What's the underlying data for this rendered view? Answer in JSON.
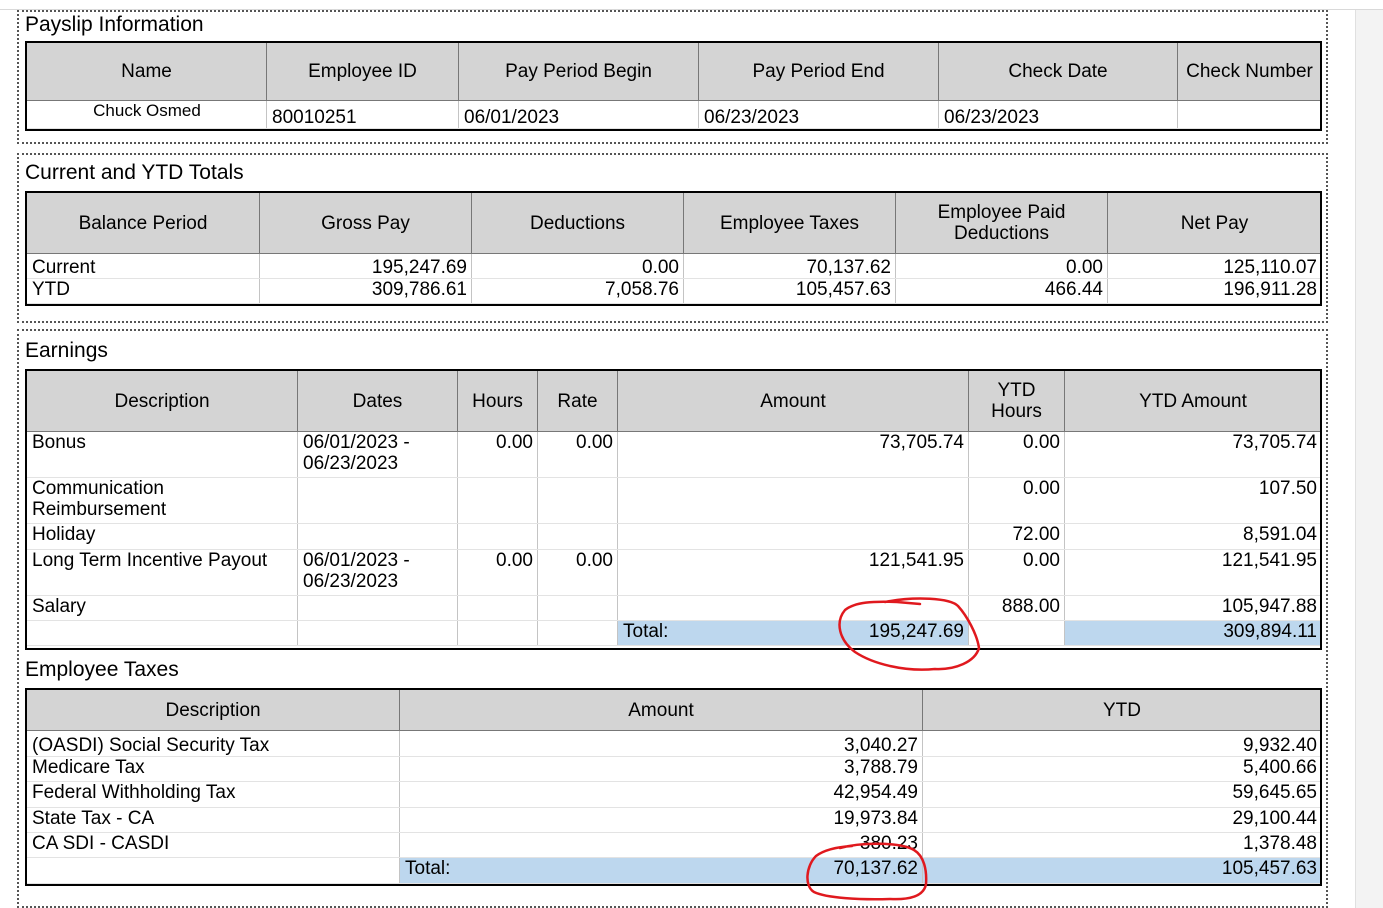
{
  "payslip": {
    "title": "Payslip Information",
    "headers": [
      "Name",
      "Employee ID",
      "Pay Period Begin",
      "Pay Period End",
      "Check Date",
      "Check Number"
    ],
    "row": [
      "Chuck Osmed",
      "80010251",
      "06/01/2023",
      "06/23/2023",
      "06/23/2023",
      ""
    ]
  },
  "totals": {
    "title": "Current and YTD Totals",
    "headers": [
      "Balance Period",
      "Gross Pay",
      "Deductions",
      "Employee Taxes",
      "Employee Paid Deductions",
      "Net Pay"
    ],
    "rows": [
      [
        "Current",
        "195,247.69",
        "0.00",
        "70,137.62",
        "0.00",
        "125,110.07"
      ],
      [
        "YTD",
        "309,786.61",
        "7,058.76",
        "105,457.63",
        "466.44",
        "196,911.28"
      ]
    ]
  },
  "earnings": {
    "title": "Earnings",
    "headers": [
      "Description",
      "Dates",
      "Hours",
      "Rate",
      "Amount",
      "YTD Hours",
      "YTD Amount"
    ],
    "rows": [
      [
        "Bonus",
        "06/01/2023 - 06/23/2023",
        "0.00",
        "0.00",
        "73,705.74",
        "0.00",
        "73,705.74"
      ],
      [
        "Communication Reimbursement",
        "",
        "",
        "",
        "",
        "0.00",
        "107.50"
      ],
      [
        "Holiday",
        "",
        "",
        "",
        "",
        "72.00",
        "8,591.04"
      ],
      [
        "Long Term Incentive Payout",
        "06/01/2023 - 06/23/2023",
        "0.00",
        "0.00",
        "121,541.95",
        "0.00",
        "121,541.95"
      ],
      [
        "Salary",
        "",
        "",
        "",
        "",
        "888.00",
        "105,947.88"
      ]
    ],
    "total_label": "Total:",
    "total_amount": "195,247.69",
    "total_ytd_amount": "309,894.11"
  },
  "taxes": {
    "title": "Employee Taxes",
    "headers": [
      "Description",
      "Amount",
      "YTD"
    ],
    "rows": [
      [
        "(OASDI) Social Security Tax",
        "3,040.27",
        "9,932.40"
      ],
      [
        "Medicare Tax",
        "3,788.79",
        "5,400.66"
      ],
      [
        "Federal Withholding Tax",
        "42,954.49",
        "59,645.65"
      ],
      [
        "State Tax - CA",
        "19,973.84",
        "29,100.44"
      ],
      [
        "CA SDI - CASDI",
        "380.23",
        "1,378.48"
      ]
    ],
    "total_label": "Total:",
    "total_amount": "70,137.62",
    "total_ytd": "105,457.63"
  },
  "annotation_color": "#e0191e"
}
